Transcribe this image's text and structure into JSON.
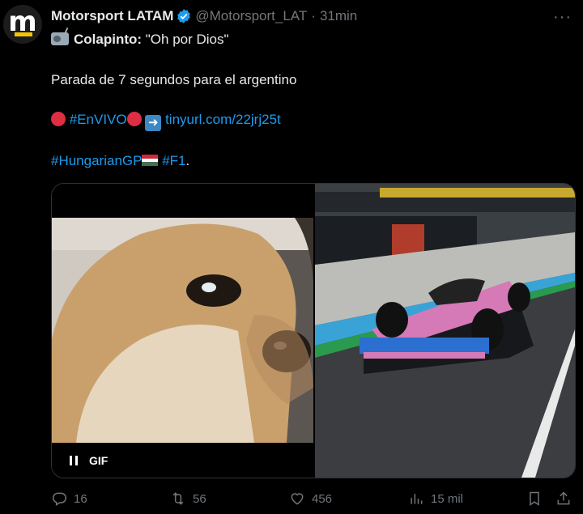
{
  "account": {
    "display_name": "Motorsport LATAM",
    "handle": "@Motorsport_LAT",
    "separator": "·",
    "time": "31min",
    "avatar_letter": "m",
    "verified_color": "#1d9bf0"
  },
  "menu": {
    "more_label": "···"
  },
  "tweet": {
    "line1_speaker": "Colapinto:",
    "line1_quote": " \"Oh por Dios\"",
    "line2": "Parada de 7 segundos para el argentino",
    "live_tag": "#EnVIVO",
    "link": "tinyurl.com/22jrj25t",
    "hashtag1": "#HungarianGP",
    "hashtag2": "#F1",
    "trailing": "."
  },
  "media": {
    "gif_label": "GIF"
  },
  "actions": {
    "replies": "16",
    "reposts": "56",
    "likes": "456",
    "views": "15 mil"
  },
  "colors": {
    "background": "#000000",
    "text": "#e7e9ea",
    "muted": "#71767b",
    "link": "#1d9bf0"
  }
}
